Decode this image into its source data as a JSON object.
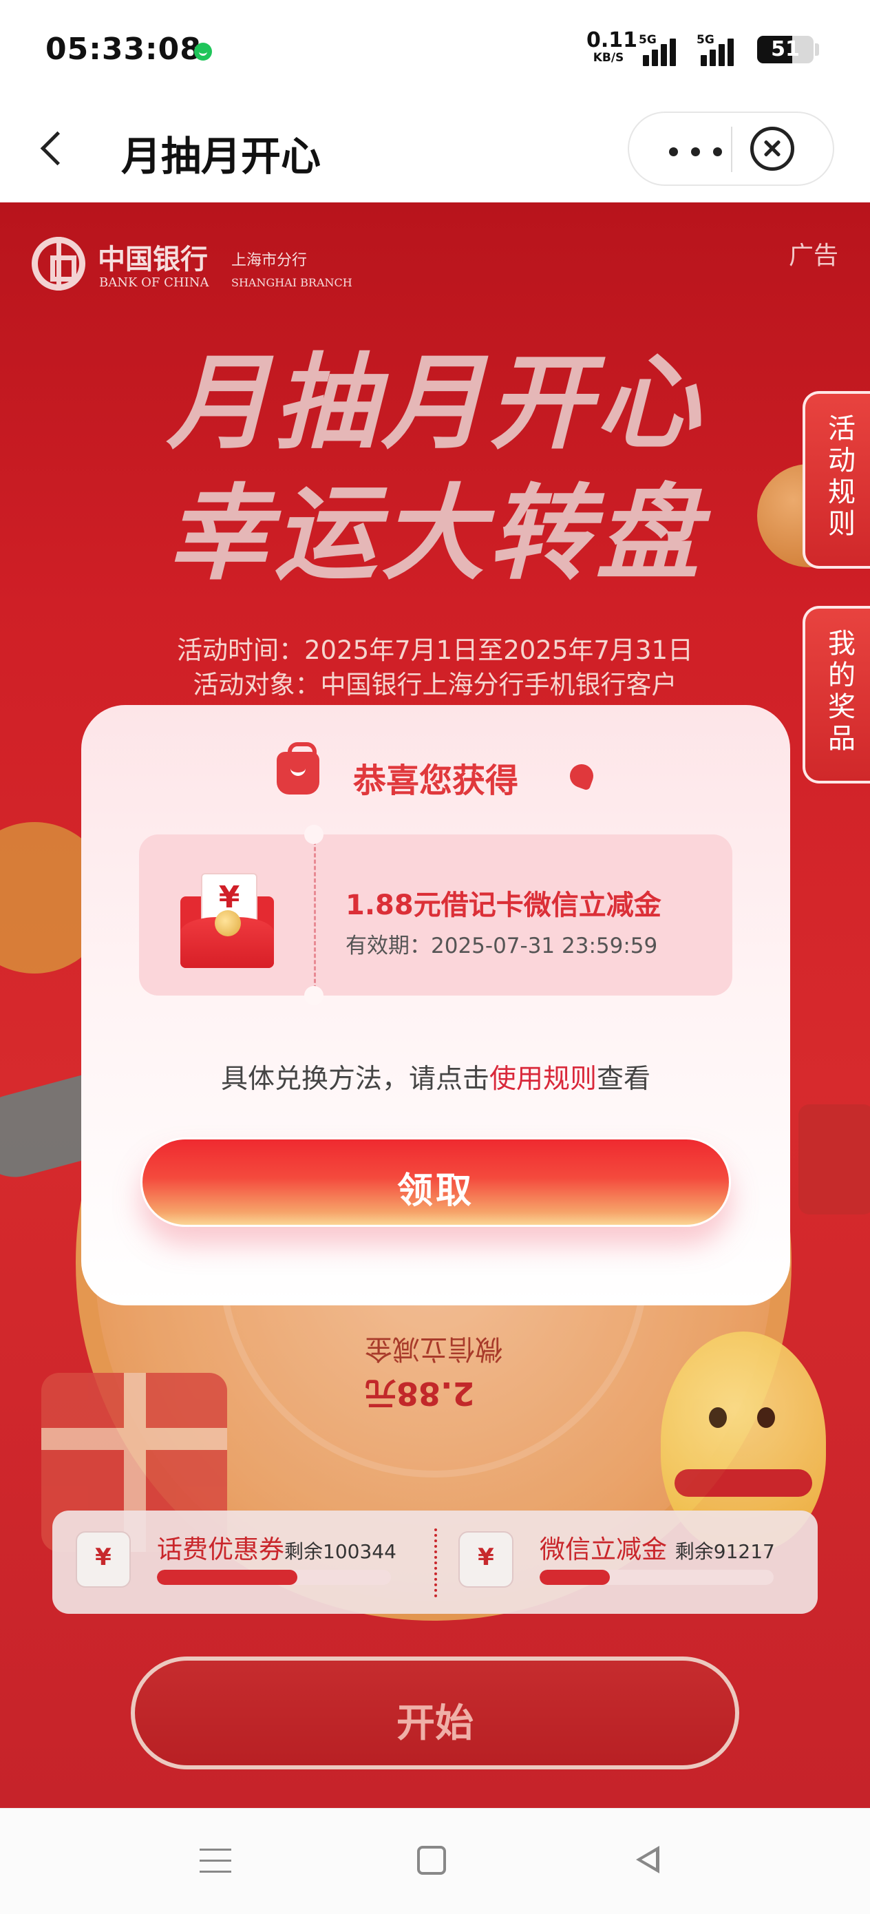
{
  "status_bar": {
    "time": "05:33:08",
    "net_speed_value": "0.11",
    "net_speed_unit": "KB/S",
    "sim1_label": "5G",
    "sim2_label": "5G",
    "battery": "51",
    "app_dot_color": "#1fc55a"
  },
  "title_bar": {
    "title": "月抽月开心",
    "back_icon": "chevron-left-icon",
    "more_icon": "more-dots-icon",
    "close_icon": "close-circle-icon"
  },
  "page": {
    "bank_name_cn": "中国银行",
    "bank_branch_cn": "上海市分行",
    "bank_name_en": "BANK OF CHINA",
    "bank_branch_en": "SHANGHAI BRANCH",
    "ad_tag": "广告",
    "headline_1": "月抽月开心",
    "headline_2": "幸运大转盘",
    "activity_time": "活动时间：2025年7月1日至2025年7月31日",
    "activity_target": "活动对象：中国银行上海分行手机银行客户",
    "wheel_prize_name": "微信立减金",
    "wheel_prize_amount": "2.88元",
    "side_tab_rules": "活动规则",
    "side_tab_prizes": "我的奖品",
    "start_button": "开始",
    "brand_color": "#d72a2d"
  },
  "prize_progress": [
    {
      "name": "话费优惠券",
      "remaining": "剩余100344",
      "progress": 0.6
    },
    {
      "name": "微信立减金",
      "remaining": "剩余91217",
      "progress": 0.3
    }
  ],
  "modal": {
    "title": "恭喜您获得",
    "coupon": {
      "name": "1.88元借记卡微信立减金",
      "expiry": "有效期：2025-07-31 23:59:59",
      "icon": "red-envelope-icon"
    },
    "hint_prefix": "具体兑换方法，请点击",
    "hint_link": "使用规则",
    "hint_suffix": "查看",
    "claim_button": "领取",
    "accent_color": "#e0383c"
  },
  "nav_bar": {
    "menu_icon": "menu-icon",
    "home_icon": "home-square-icon",
    "back_icon": "back-triangle-icon"
  }
}
